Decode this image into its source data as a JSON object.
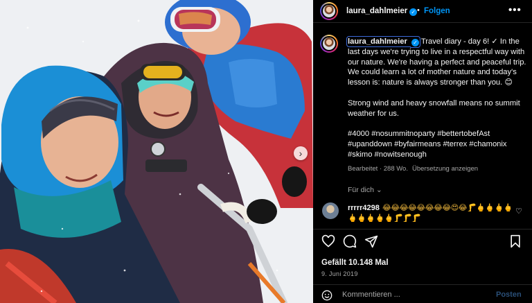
{
  "header": {
    "username": "laura_dahlmeier",
    "separator": "•",
    "follow_label": "Folgen",
    "more_label": "•••"
  },
  "caption": {
    "username": "laura_dahlmeier",
    "paragraph1": "Travel diary - day 6! ✓ In the last days we're trying to live in a respectful way with our nature. We're having a perfect and peaceful trip. We could learn a lot of mother nature and today's lesson is: nature is always stronger than you. 😊",
    "paragraph2": "Strong wind and heavy snowfall means no summit weather for us.",
    "hashtags": "#4000 #nosummitnoparty #bettertobefAst #upanddown #byfairmeans #terrex #chamonix #skimo #nowitsenough"
  },
  "meta": {
    "edited": "Bearbeitet · 288 Wo.",
    "translate": "Übersetzung anzeigen"
  },
  "for_you": "Für dich ⌄",
  "comment": {
    "username": "rrrrr4298",
    "text": "😂😂😂😂😂😂😂😂😍😂🦵🖕🖕🖕🖕 🖕🖕🖕🖕🖕🦵🦵🦵"
  },
  "post": {
    "likes": "Gefällt 10.148 Mal",
    "date": "9. Juni 2019"
  },
  "comment_box": {
    "placeholder": "Kommentieren ...",
    "post_label": "Posten"
  },
  "colors": {
    "accent": "#0095f6",
    "muted": "#a8a8a8",
    "post_disabled": "#2a4f78"
  },
  "icons": {
    "carousel": "chevron-right-icon",
    "like": "heart-icon",
    "comment": "comment-bubble-icon",
    "share": "paper-plane-icon",
    "save": "bookmark-icon",
    "emoji": "smiley-icon"
  }
}
